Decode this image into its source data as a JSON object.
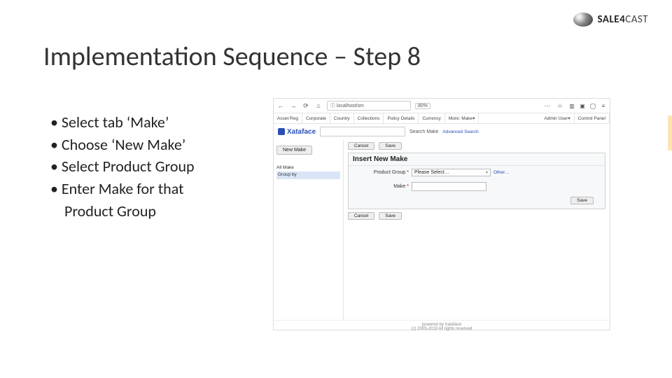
{
  "logo": {
    "brand": "SALE",
    "brand2": "4",
    "brand3": "CAST"
  },
  "title": "Implementation Sequence – Step 8",
  "bullets": [
    "• Select tab ‘Make’",
    "• Choose ‘New Make’",
    "• Select Product Group",
    "• Enter Make for that",
    "Product Group"
  ],
  "browser": {
    "url": "localhost/sm",
    "zoom": "80%",
    "menu": [
      "Asset Reg",
      "Corporate",
      "Country",
      "Collections",
      "Policy Details",
      "Currency",
      "More: Make"
    ],
    "menu_right": [
      "Admin User",
      "Control Panel"
    ],
    "brand": "Xataface",
    "search_label": "Search Make",
    "advanced": "Advanced Search",
    "new_make_btn": "New Make",
    "left_items": [
      "All Make",
      "Group by"
    ],
    "cancel": "Cancel",
    "save": "Save",
    "form_title": "Insert New Make",
    "pg_label": "Product Group",
    "pg_placeholder": "Please Select…",
    "pg_other": "Other…",
    "make_label": "Make",
    "footer1": "powered by Xataface",
    "footer2": "(c) 2005-2019 All rights reserved"
  }
}
